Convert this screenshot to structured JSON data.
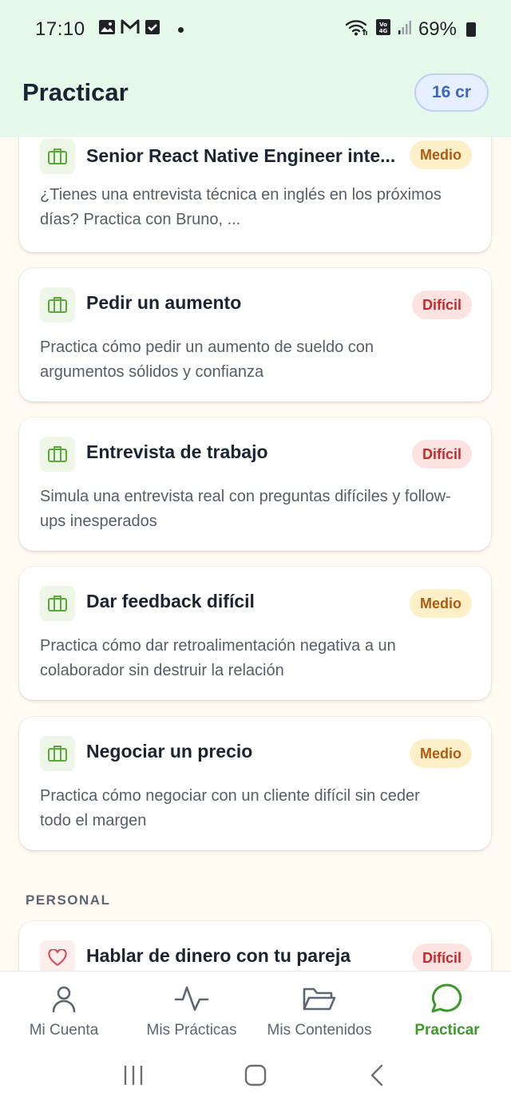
{
  "status_bar": {
    "time": "17:10",
    "battery": "69%"
  },
  "header": {
    "title": "Practicar",
    "credits": "16 cr"
  },
  "cards": [
    {
      "title": "Senior React Native Engineer inte...",
      "badge": "Medio",
      "badge_type": "medio",
      "description": "¿Tienes una entrevista técnica en inglés en los próximos días? Practica con Bruno, ...",
      "icon": "briefcase-icon"
    },
    {
      "title": "Pedir un aumento",
      "badge": "Difícil",
      "badge_type": "dificil",
      "description": "Practica cómo pedir un aumento de sueldo con argumentos sólidos y confianza",
      "icon": "briefcase-icon"
    },
    {
      "title": "Entrevista de trabajo",
      "badge": "Difícil",
      "badge_type": "dificil",
      "description": "Simula una entrevista real con preguntas difíciles y follow-ups inesperados",
      "icon": "briefcase-icon"
    },
    {
      "title": "Dar feedback difícil",
      "badge": "Medio",
      "badge_type": "medio",
      "description": "Practica cómo dar retroalimentación negativa a un colaborador sin destruir la relación",
      "icon": "briefcase-icon"
    },
    {
      "title": "Negociar un precio",
      "badge": "Medio",
      "badge_type": "medio",
      "description": "Practica cómo negociar con un cliente difícil sin ceder todo el margen",
      "icon": "briefcase-icon"
    }
  ],
  "sections": {
    "personal_label": "PERSONAL"
  },
  "personal_cards": [
    {
      "title": "Hablar de dinero con tu pareja",
      "badge": "Difícil",
      "badge_type": "dificil",
      "icon": "heart-icon"
    }
  ],
  "bottom_nav": {
    "items": [
      {
        "label": "Mi Cuenta",
        "icon": "user-icon"
      },
      {
        "label": "Mis Prácticas",
        "icon": "activity-icon"
      },
      {
        "label": "Mis Contenidos",
        "icon": "folder-icon"
      },
      {
        "label": "Practicar",
        "icon": "chat-bubble-icon",
        "active": true
      }
    ]
  },
  "colors": {
    "accent": "#3c9a2a",
    "header_bg": "#e6f8ea",
    "page_bg": "#fffaf2",
    "medio_bg": "#fdf0c9",
    "dificil_bg": "#fde2e2"
  }
}
